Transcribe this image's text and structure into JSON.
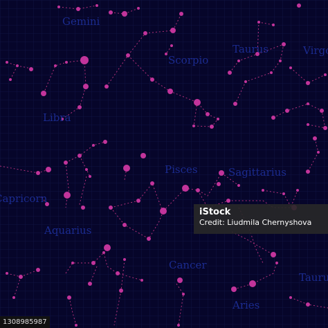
{
  "colors": {
    "background": "#06052a",
    "grid": "#101242",
    "lines": "#b1307a",
    "stars": "#c2349b",
    "labels": "#1b2b8f"
  },
  "labels": [
    "Gemini",
    "Taurus",
    "Virgo",
    "Scorpio",
    "Libra",
    "Pisces",
    "Sagittarius",
    "Capricorn",
    "Aquarius",
    "Cancer",
    "Aries",
    "Taurus"
  ],
  "credit": {
    "logo": "iStock",
    "author": "Credit: Liudmila Chernyshova"
  },
  "stock_id": "1308985987"
}
